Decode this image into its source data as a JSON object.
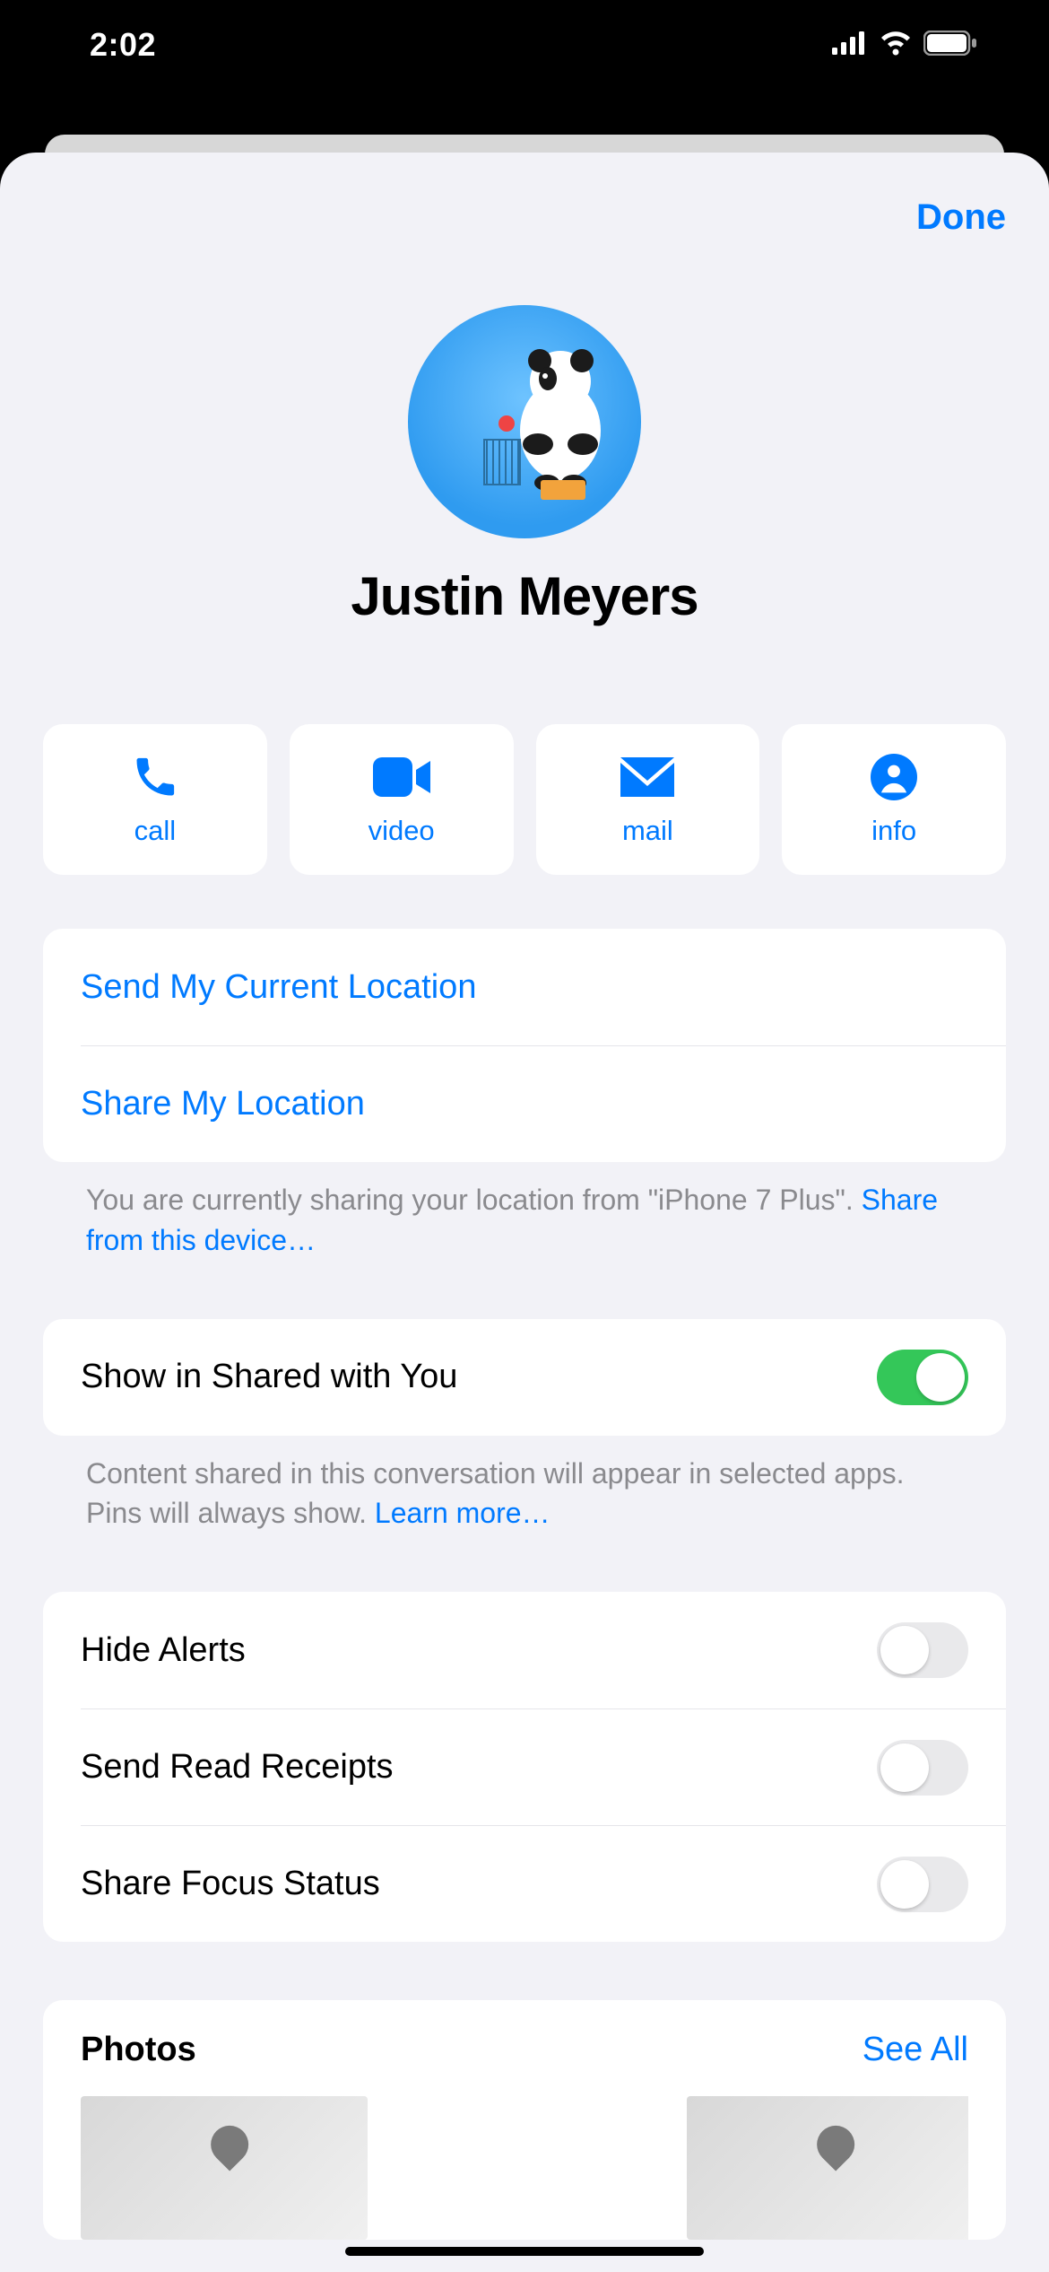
{
  "status": {
    "time": "2:02"
  },
  "sheet": {
    "done_label": "Done",
    "contact_name": "Justin Meyers",
    "actions": {
      "call": "call",
      "video": "video",
      "mail": "mail",
      "info": "info"
    },
    "location_group": {
      "send_current": "Send My Current Location",
      "share_my": "Share My Location",
      "footer_prefix": "You are currently sharing your location from \"iPhone 7 Plus\". ",
      "footer_link": "Share from this device…"
    },
    "shared_with_you": {
      "label": "Show in Shared with You",
      "enabled": true,
      "footer_prefix": "Content shared in this conversation will appear in selected apps. Pins will always show. ",
      "footer_link": "Learn more…"
    },
    "toggles_group": {
      "hide_alerts": {
        "label": "Hide Alerts",
        "enabled": false
      },
      "read_receipts": {
        "label": "Send Read Receipts",
        "enabled": false
      },
      "focus_status": {
        "label": "Share Focus Status",
        "enabled": false
      }
    },
    "photos": {
      "title": "Photos",
      "see_all": "See All"
    }
  }
}
